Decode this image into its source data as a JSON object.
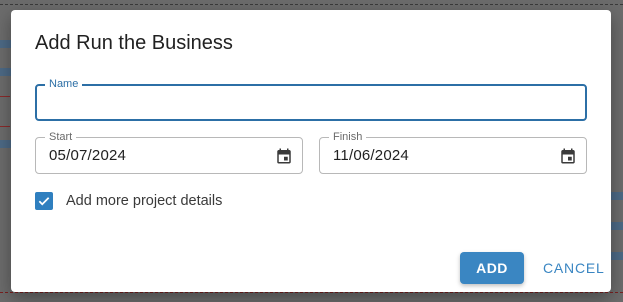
{
  "dialog": {
    "title": "Add Run the Business",
    "name_field": {
      "label": "Name",
      "value": ""
    },
    "start_field": {
      "label": "Start",
      "value": "05/07/2024",
      "icon": "calendar-icon"
    },
    "finish_field": {
      "label": "Finish",
      "value": "11/06/2024",
      "icon": "calendar-icon"
    },
    "more_details": {
      "label": "Add more project details",
      "checked": true
    },
    "add_label": "ADD",
    "cancel_label": "CANCEL"
  },
  "colors": {
    "accent": "#3a86c2",
    "focus_border": "#2c6fa6",
    "checkbox": "#2f7fbf"
  }
}
